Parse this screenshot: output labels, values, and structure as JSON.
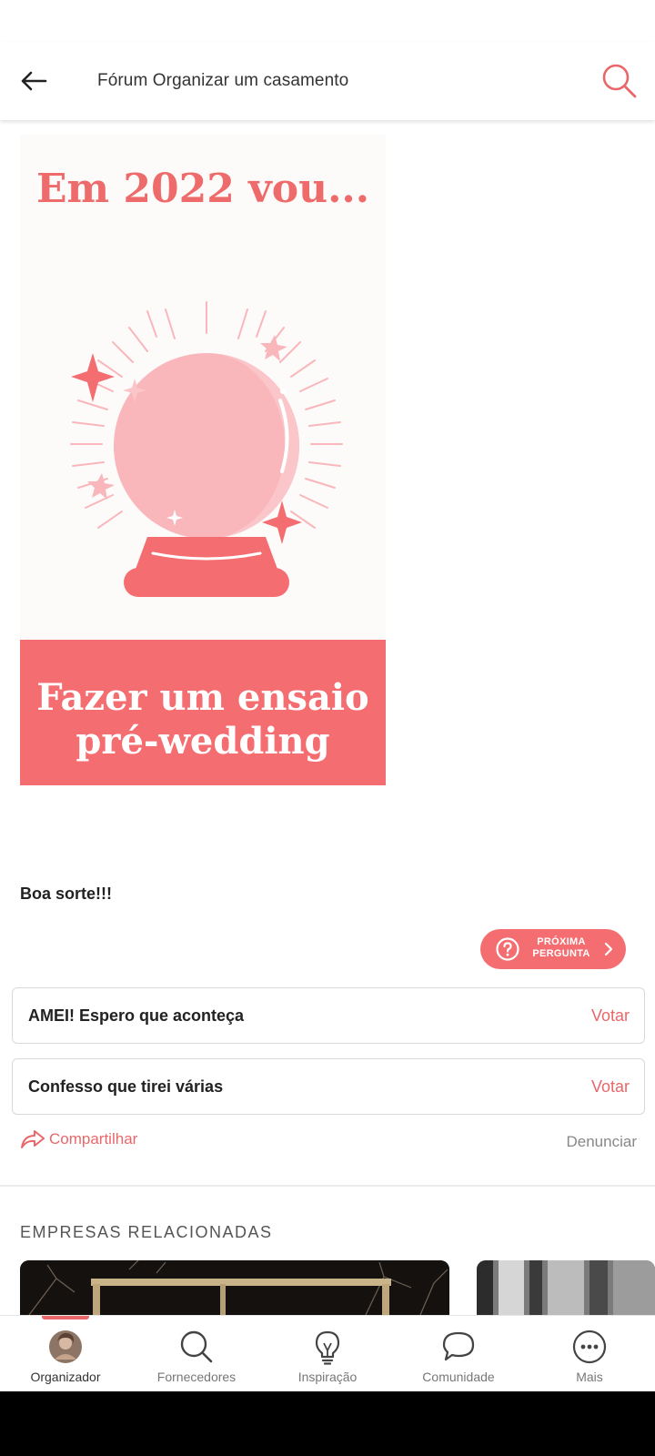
{
  "header": {
    "title": "Fórum Organizar um casamento",
    "back_icon": "arrow-left-icon",
    "search_icon": "search-icon",
    "accent_color": "#e9676a"
  },
  "poster": {
    "heading": "Em 2022 vou...",
    "band_line_1": "Fazer um ensaio",
    "band_line_2": "pré-wedding",
    "art_icon": "crystal-ball-illustration",
    "colors": {
      "coral": "#f46d70",
      "pink": "#f9b7bb",
      "background": "#fdfbfa"
    }
  },
  "post": {
    "text": "Boa sorte!!!"
  },
  "next_question": {
    "line_1": "PRÓXIMA",
    "line_2": "PERGUNTA",
    "icon": "question-circle-icon"
  },
  "poll": {
    "options": [
      {
        "text": "AMEI! Espero que aconteça",
        "vote_label": "Votar"
      },
      {
        "text": "Confesso que tirei várias",
        "vote_label": "Votar"
      }
    ]
  },
  "actions": {
    "share_label": "Compartilhar",
    "report_label": "Denunciar"
  },
  "related": {
    "title": "EMPRESAS RELACIONADAS"
  },
  "bottom_nav": {
    "items": [
      {
        "label": "Organizador",
        "icon": "avatar-icon",
        "active": true
      },
      {
        "label": "Fornecedores",
        "icon": "search-icon",
        "active": false
      },
      {
        "label": "Inspiração",
        "icon": "lightbulb-icon",
        "active": false
      },
      {
        "label": "Comunidade",
        "icon": "chat-bubble-icon",
        "active": false
      },
      {
        "label": "Mais",
        "icon": "more-dots-icon",
        "active": false
      }
    ]
  }
}
